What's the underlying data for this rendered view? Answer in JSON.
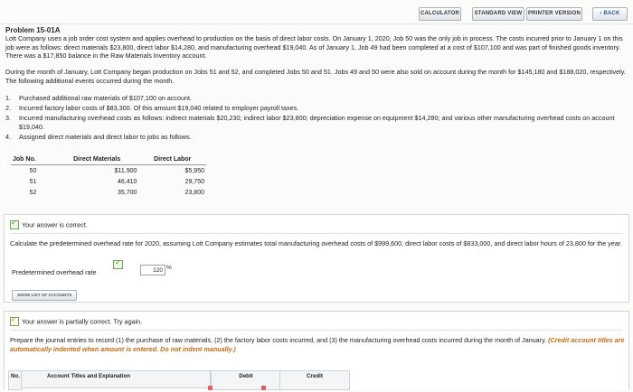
{
  "toolbar": {
    "calculator": "CALCULATOR",
    "standard_view": "STANDARD VIEW",
    "printer_version": "PRINTER VERSION",
    "back": "‹ BACK"
  },
  "problem": {
    "title": "Problem 15-01A",
    "para1": "Lott Company uses a job order cost system and applies overhead to production on the basis of direct labor costs. On January 1, 2020, Job 50 was the only job in process. The costs incurred prior to January 1 on this job were as follows: direct materials $23,800, direct labor $14,280, and manufacturing overhead $19,040. As of January 1, Job 49 had been completed at a cost of $107,100 and was part of finished goods inventory. There was a $17,850 balance in the Raw Materials Inventory account.",
    "para2": "During the month of January, Lott Company began production on Jobs 51 and 52, and completed Jobs 50 and 51. Jobs 49 and 50 were also sold on account during the month for $145,180 and $188,020, respectively. The following additional events occurred during the month.",
    "items": [
      {
        "num": "1.",
        "text": "Purchased additional raw materials of $107,100 on account."
      },
      {
        "num": "2.",
        "text": "Incurred factory labor costs of $83,300. Of this amount $19,040 related to employer payroll taxes."
      },
      {
        "num": "3.",
        "text": "Incurred manufacturing overhead costs as follows: indirect materials $20,230; indirect labor $23,800; depreciation expense on equipment $14,280; and various other manufacturing overhead costs on account $19,040."
      },
      {
        "num": "4.",
        "text": "Assigned direct materials and direct labor to jobs as follows."
      }
    ]
  },
  "jobs_table": {
    "headers": [
      "Job No.",
      "Direct Materials",
      "Direct Labor"
    ],
    "rows": [
      [
        "50",
        "$11,900",
        "$5,950"
      ],
      [
        "51",
        "46,410",
        "29,750"
      ],
      [
        "52",
        "35,700",
        "23,800"
      ]
    ]
  },
  "part1": {
    "status": "Your answer is correct.",
    "instruction": "Calculate the predetermined overhead rate for 2020, assuming Lott Company estimates total manufacturing overhead costs of $999,600, direct labor costs of $833,000, and direct labor hours of 23,800 for the year.",
    "rate_label": "Predetermined overhead rate",
    "rate_value": "120",
    "rate_unit": "%",
    "show_accounts": "SHOW LIST OF ACCOUNTS"
  },
  "part2": {
    "status": "Your answer is partially correct.  Try again.",
    "instruction": "Prepare the journal entries to record (1) the purchase of raw materials, (2) the factory labor costs incurred, and (3) the manufacturing overhead costs incurred during the month of January.",
    "credit_note": "(Credit account titles are automatically indented when amount is entered. Do not indent manually.)",
    "col_no": "No.",
    "col_account": "Account Titles and Explanation",
    "col_debit": "Debit",
    "col_credit": "Credit"
  }
}
